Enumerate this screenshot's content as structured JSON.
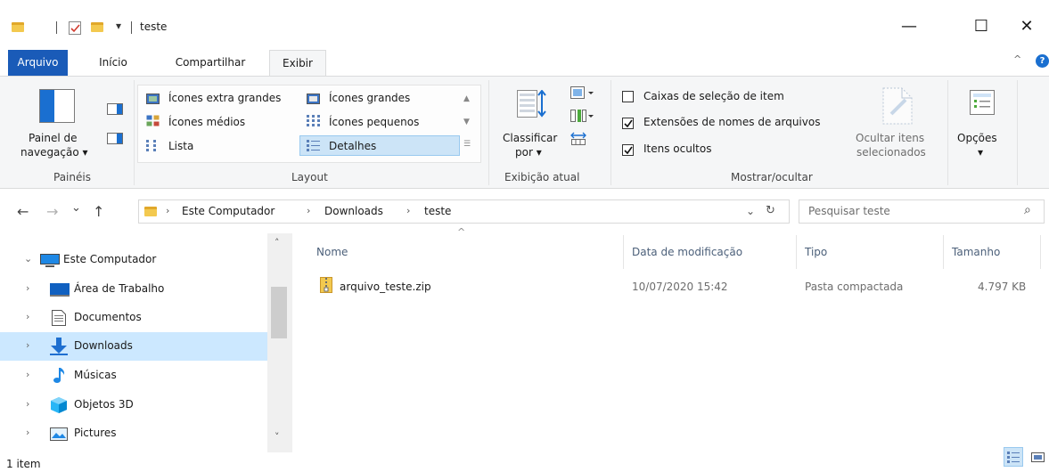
{
  "window": {
    "title": "teste",
    "minimize_glyph": "—",
    "maximize_glyph": "☐",
    "close_glyph": "✕"
  },
  "quick_access": {
    "dropdown_glyph": "▾"
  },
  "ribbon_tabs": [
    {
      "label": "Arquivo"
    },
    {
      "label": "Início"
    },
    {
      "label": "Compartilhar"
    },
    {
      "label": "Exibir"
    }
  ],
  "ribbon": {
    "help_glyph": "?",
    "collapse_glyph": "^",
    "paineis": {
      "nav_pane_line1": "Painel de",
      "nav_pane_line2": "navegação ▾",
      "group_label": "Painéis"
    },
    "layout": {
      "options": [
        "Ícones extra grandes",
        "Ícones grandes",
        "Ícones médios",
        "Ícones pequenos",
        "Lista",
        "Detalhes"
      ],
      "selected": "Detalhes",
      "group_label": "Layout"
    },
    "exibicao_atual": {
      "sort_line1": "Classificar",
      "sort_line2": "por ▾",
      "group_label": "Exibição atual"
    },
    "mostrar_ocultar": {
      "checkboxes": [
        {
          "label": "Caixas de seleção de item",
          "checked": false
        },
        {
          "label": "Extensões de nomes de arquivos",
          "checked": true
        },
        {
          "label": "Itens ocultos",
          "checked": true
        }
      ],
      "hide_selected_line1": "Ocultar itens",
      "hide_selected_line2": "selecionados",
      "group_label": "Mostrar/ocultar"
    },
    "opcoes": {
      "label": "Opções",
      "dropdown_glyph": "▾"
    }
  },
  "address": {
    "back_glyph": "←",
    "forward_glyph": "→",
    "recent_glyph": "⌄",
    "up_glyph": "↑",
    "breadcrumbs": [
      "Este Computador",
      "Downloads",
      "teste"
    ],
    "separator": "›",
    "dropdown_glyph": "⌄",
    "refresh_glyph": "↻"
  },
  "search": {
    "placeholder": "Pesquisar teste",
    "glyph": "⌕"
  },
  "nav_pane": {
    "items": [
      {
        "label": "Este Computador",
        "expanded": true,
        "icon": "computer-icon"
      },
      {
        "label": "Área de Trabalho",
        "icon": "desktop-icon"
      },
      {
        "label": "Documentos",
        "icon": "documents-icon"
      },
      {
        "label": "Downloads",
        "icon": "downloads-icon",
        "selected": true
      },
      {
        "label": "Músicas",
        "icon": "music-icon"
      },
      {
        "label": "Objetos 3D",
        "icon": "objects3d-icon"
      },
      {
        "label": "Pictures",
        "icon": "pictures-icon"
      }
    ],
    "scroll_up_glyph": "˄",
    "scroll_down_glyph": "˅"
  },
  "file_list": {
    "columns": [
      "Nome",
      "Data de modificação",
      "Tipo",
      "Tamanho"
    ],
    "sort_glyph": "^",
    "rows": [
      {
        "name": "arquivo_teste.zip",
        "modified": "10/07/2020 15:42",
        "type": "Pasta compactada",
        "size": "4.797 KB"
      }
    ]
  },
  "status_bar": {
    "item_count": "1 item"
  },
  "colors": {
    "file_tab": "#1a5bb8",
    "selection": "#cce8ff",
    "ribbon_bg": "#f5f6f7",
    "folder_yellow": "#f3c94f"
  }
}
